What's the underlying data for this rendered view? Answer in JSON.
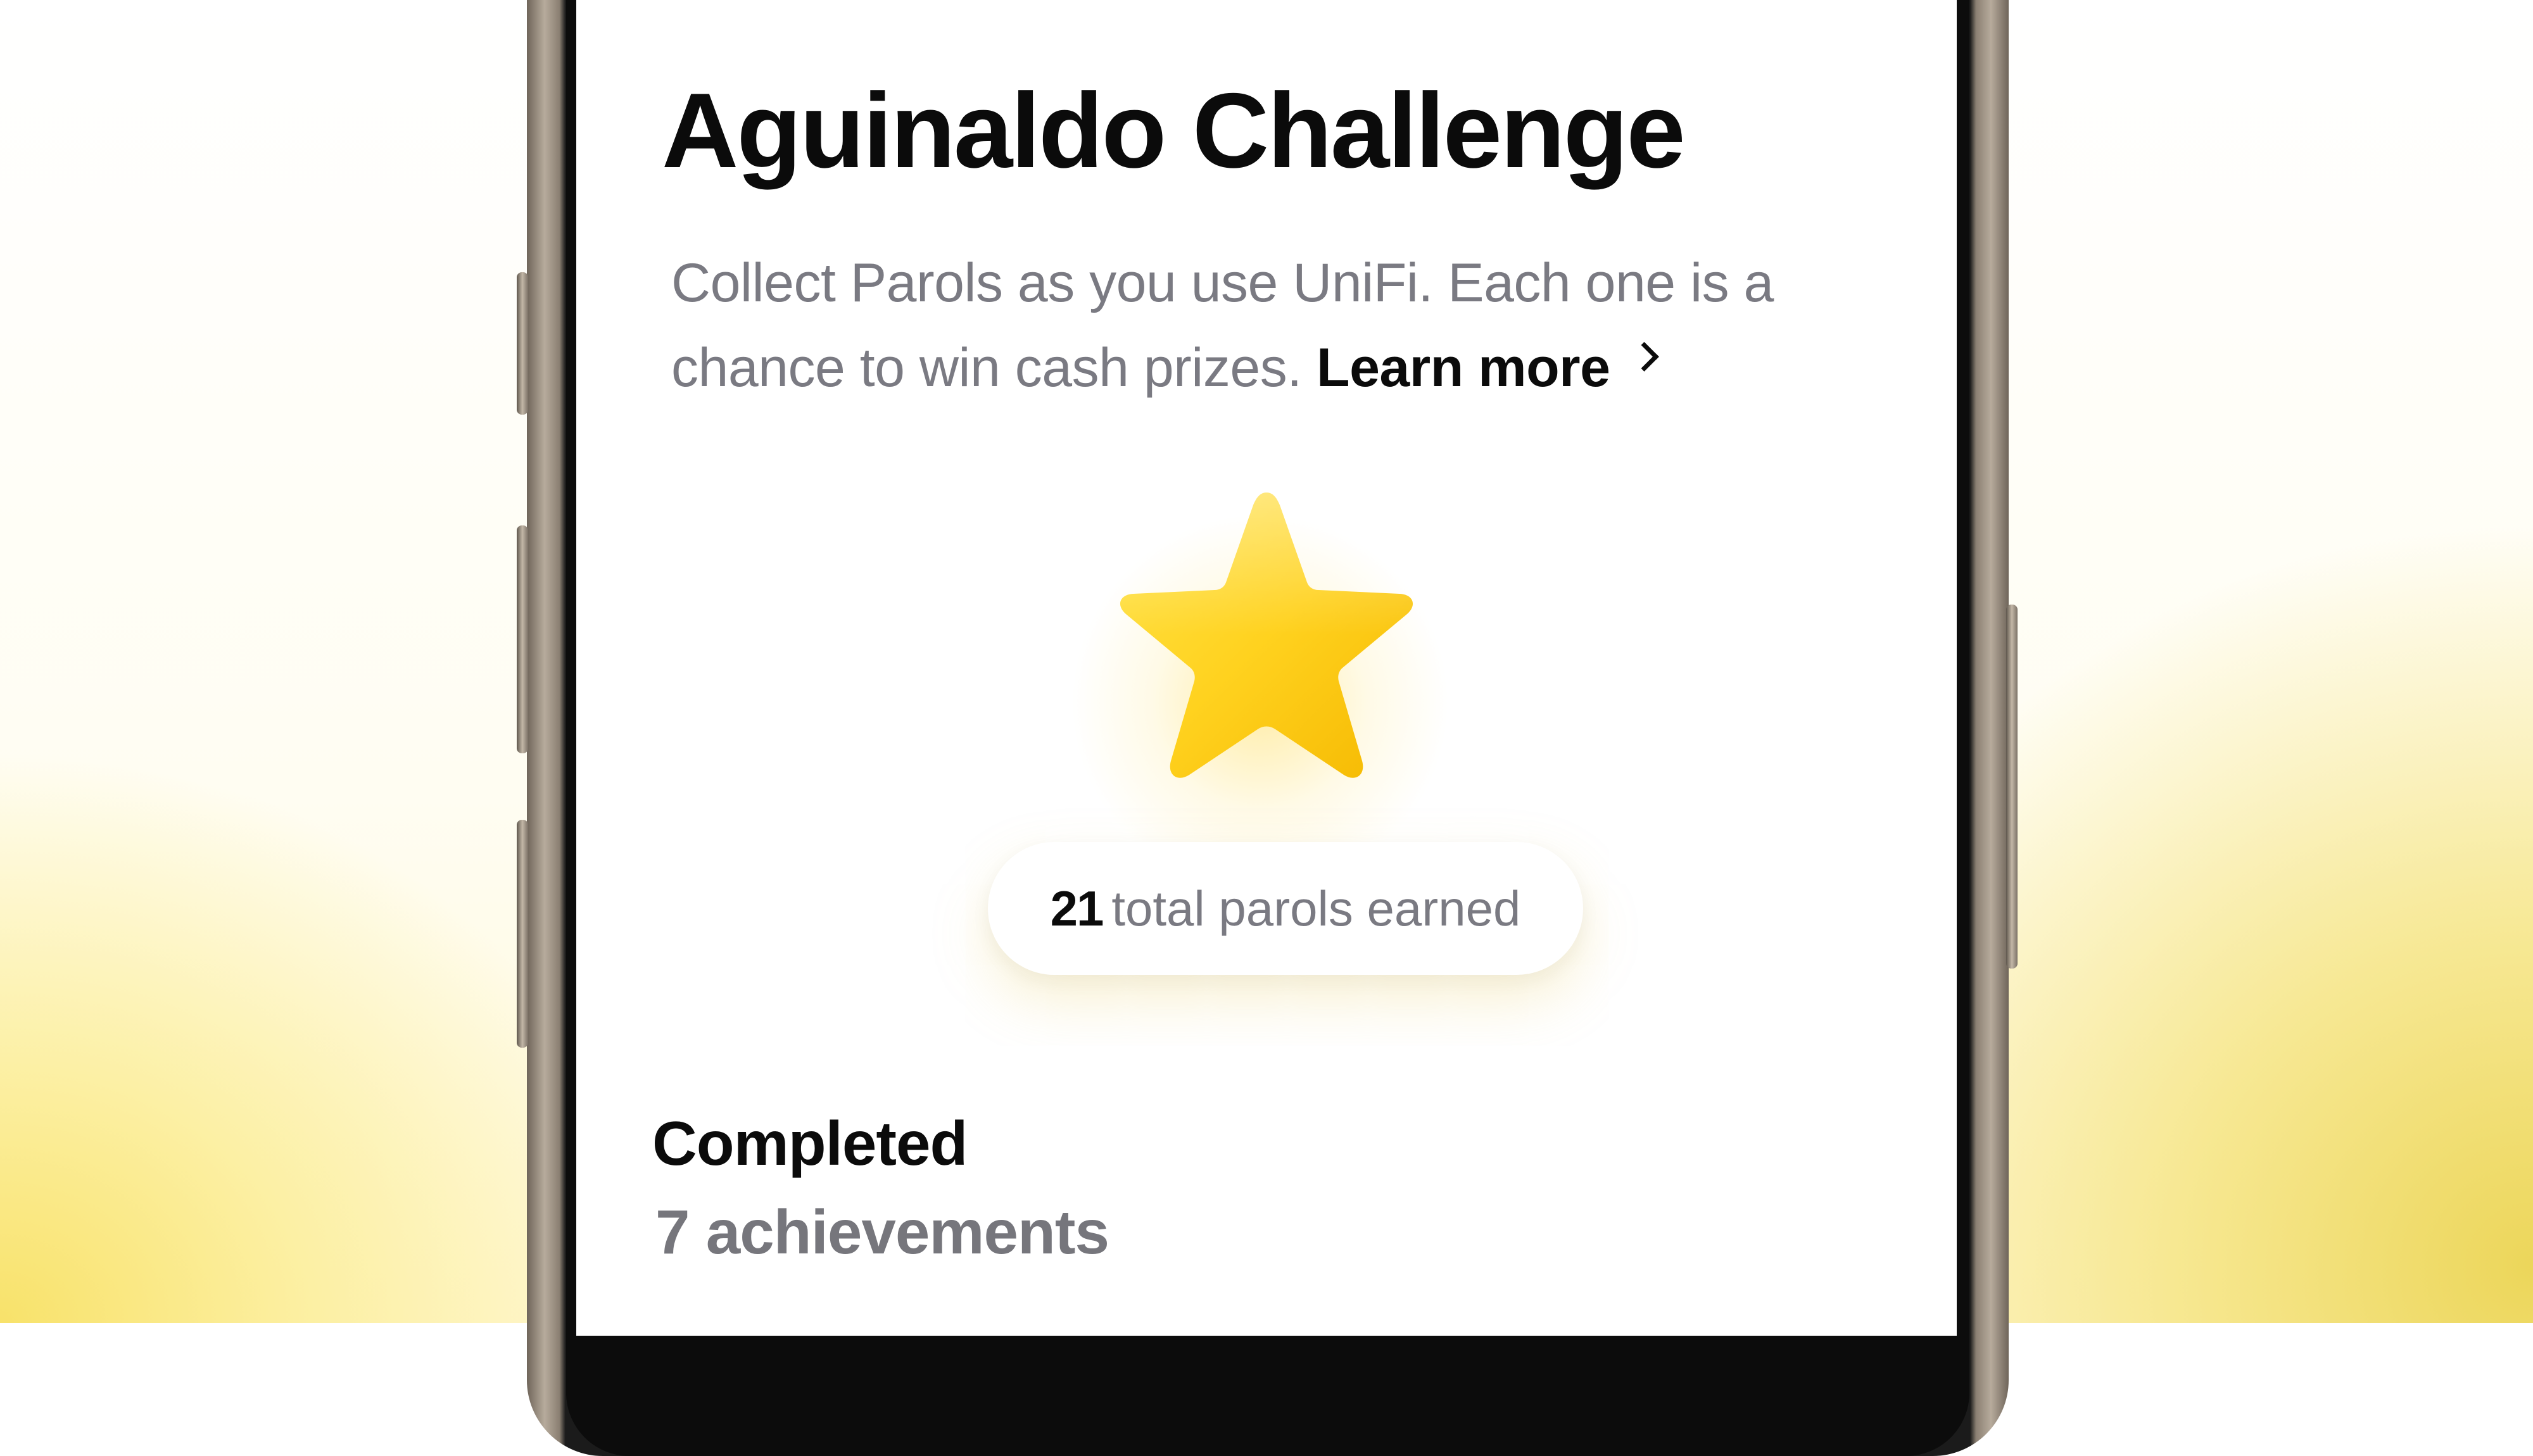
{
  "colors": {
    "accent_star": "#FFD21F",
    "title_text": "#0b0b0b",
    "secondary_text": "#7a7a82",
    "background_glow": "#F6E46A"
  },
  "challenge": {
    "title": "Aguinaldo Challenge",
    "description": "Collect Parols as you use UniFi. Each one is a chance to win cash prizes.",
    "learn_more_label": "Learn more",
    "learn_more_icon": "chevron-right-icon",
    "badge_icon": "star-icon"
  },
  "parols": {
    "count": "21",
    "label": "total parols earned"
  },
  "completed": {
    "heading": "Completed",
    "subtitle": "7 achievements"
  }
}
